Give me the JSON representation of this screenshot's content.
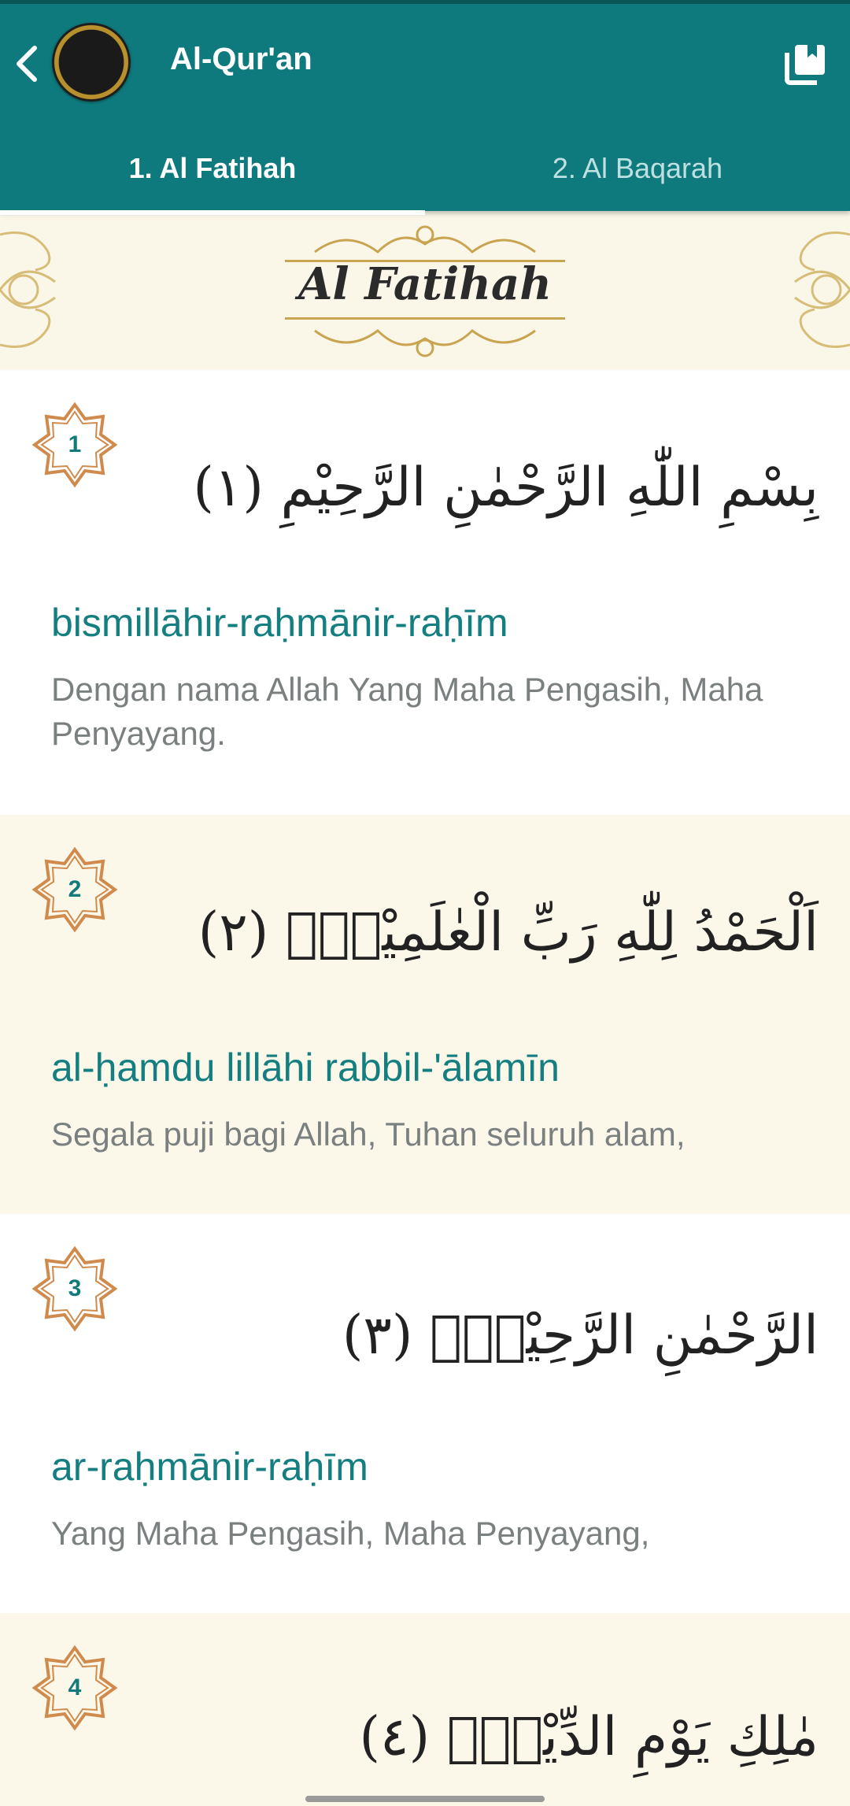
{
  "app": {
    "title": "Al-Qur'an",
    "accent_color": "#0e7a7d"
  },
  "tabs": [
    {
      "label": "1. Al Fatihah",
      "active": true
    },
    {
      "label": "2. Al Baqarah",
      "active": false
    }
  ],
  "banner": {
    "title": "Al Fatihah"
  },
  "verses": [
    {
      "number": "1",
      "arabic": "بِسْمِ اللّٰهِ الرَّحْمٰنِ الرَّحِيْمِ (١)",
      "latin": "bismillāhir-raḥmānir-raḥīm",
      "translation": "Dengan nama Allah Yang Maha Pengasih, Maha Penyayang."
    },
    {
      "number": "2",
      "arabic": "اَلْحَمْدُ لِلّٰهِ رَبِّ الْعٰلَمِيْنَۙ (٢)",
      "latin": "al-ḥamdu lillāhi rabbil-'ālamīn",
      "translation": "Segala puji bagi Allah, Tuhan seluruh alam,"
    },
    {
      "number": "3",
      "arabic": "الرَّحْمٰنِ الرَّحِيْمِۙ (٣)",
      "latin": "ar-raḥmānir-raḥīm",
      "translation": "Yang Maha Pengasih, Maha Penyayang,"
    },
    {
      "number": "4",
      "arabic": "مٰلِكِ يَوْمِ الدِّيْنِۗ (٤)",
      "latin": "",
      "translation": ""
    }
  ]
}
